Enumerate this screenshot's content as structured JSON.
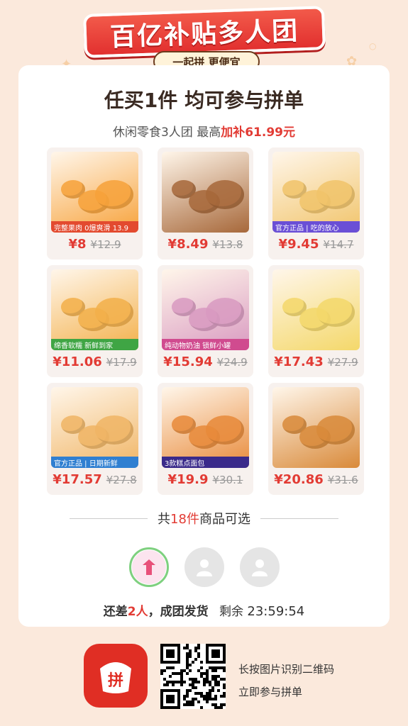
{
  "banner": {
    "title": "百亿补贴多人团",
    "subtitle": "一起拼 更便宜"
  },
  "card": {
    "headline": "任买1件 均可参与拼单",
    "sub_prefix": "休闲零食3人团 最高",
    "sub_highlight": "加补61.99元"
  },
  "products": [
    {
      "ribbon": "完整果肉 0爆爽滑 13.9",
      "price": "¥8",
      "orig": "¥12.9",
      "color": "#f7a23a",
      "ribbon_color": "#e34a2f"
    },
    {
      "ribbon": "",
      "price": "¥8.49",
      "orig": "¥13.8",
      "color": "#a7683a",
      "ribbon_color": ""
    },
    {
      "ribbon": "官方正品 | 吃的放心",
      "price": "¥9.45",
      "orig": "¥14.7",
      "color": "#f1c46a",
      "ribbon_color": "#6a4fd6"
    },
    {
      "ribbon": "绵香软糯  新鲜到家",
      "price": "¥11.06",
      "orig": "¥17.9",
      "color": "#f3b04a",
      "ribbon_color": "#3fa544"
    },
    {
      "ribbon": "纯动物奶油  锁鲜小罐",
      "price": "¥15.94",
      "orig": "¥24.9",
      "color": "#d99ac1",
      "ribbon_color": "#d04b8f"
    },
    {
      "ribbon": "",
      "price": "¥17.43",
      "orig": "¥27.9",
      "color": "#f4d86a",
      "ribbon_color": ""
    },
    {
      "ribbon": "官方正品 | 日期新鲜",
      "price": "¥17.57",
      "orig": "¥27.8",
      "color": "#f0b565",
      "ribbon_color": "#2f7fd1"
    },
    {
      "ribbon": "3款糕点面包",
      "price": "¥19.9",
      "orig": "¥30.1",
      "color": "#e88a3a",
      "ribbon_color": "#3a2a8a"
    },
    {
      "ribbon": "",
      "price": "¥20.86",
      "orig": "¥31.6",
      "color": "#d98a3a",
      "ribbon_color": ""
    }
  ],
  "count": {
    "prefix": "共",
    "number": "18件",
    "suffix": "商品可选"
  },
  "status": {
    "prefix": "还差",
    "number": "2人",
    "suffix": "，成团发货",
    "remaining_label": "剩余",
    "timer": "23:59:54"
  },
  "footer": {
    "logo_text": "拼",
    "line1": "长按图片识别二维码",
    "line2": "立即参与拼单"
  },
  "icons": {
    "leader_avatar": "shopping-bag-icon",
    "empty_avatar": "user-placeholder-icon"
  }
}
